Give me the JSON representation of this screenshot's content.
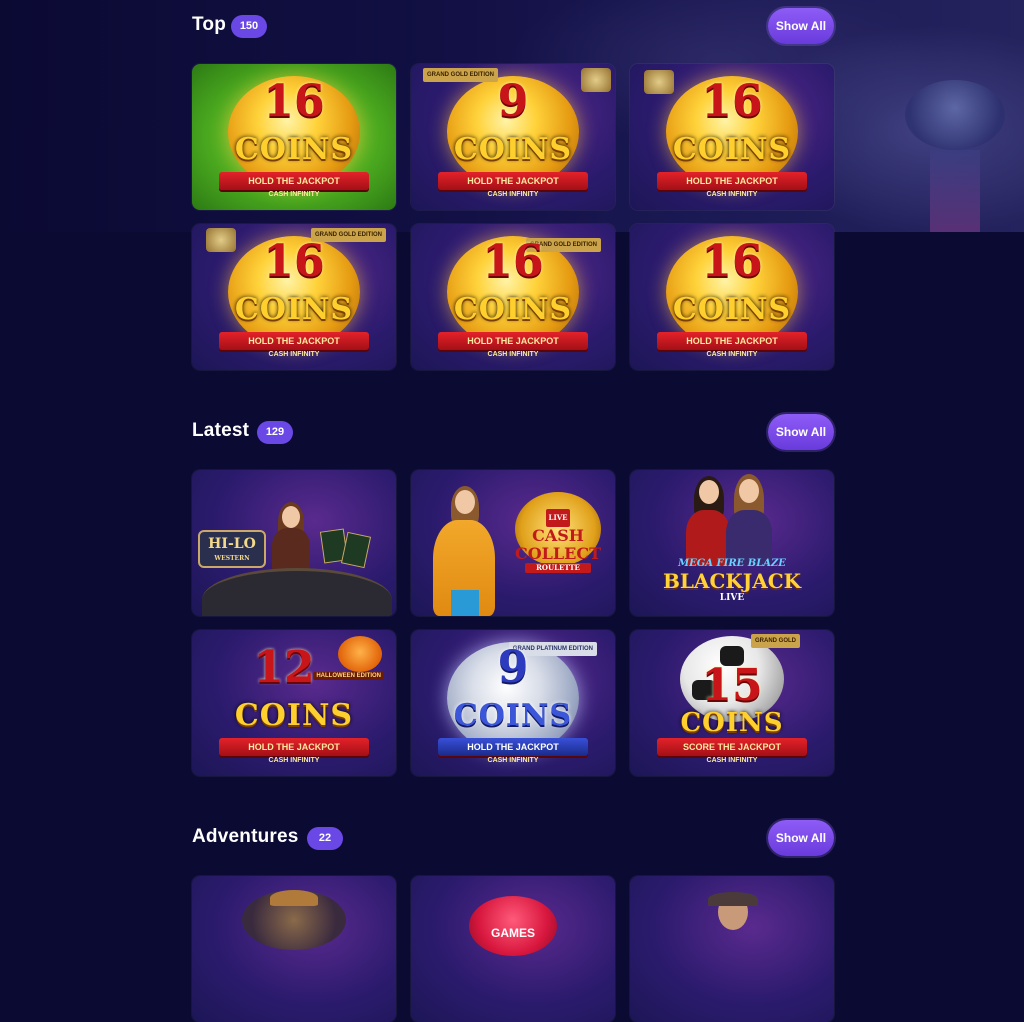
{
  "sections": [
    {
      "title": "Top",
      "count": "150",
      "show_all": "Show All",
      "games": [
        {
          "number": "16",
          "word": "COINS",
          "ribbon": "HOLD THE JACKPOT",
          "sub": "CASH INFINITY"
        },
        {
          "number": "9",
          "word": "COINS",
          "ribbon": "HOLD THE JACKPOT",
          "sub": "CASH INFINITY",
          "badge": "GRAND GOLD EDITION"
        },
        {
          "number": "16",
          "word": "COINS",
          "ribbon": "HOLD THE JACKPOT",
          "sub": "CASH INFINITY"
        },
        {
          "number": "16",
          "word": "COINS",
          "ribbon": "HOLD THE JACKPOT",
          "sub": "CASH INFINITY",
          "badge": "GRAND GOLD EDITION"
        },
        {
          "number": "16",
          "word": "COINS",
          "ribbon": "HOLD THE JACKPOT",
          "sub": "CASH INFINITY",
          "badge": "GRAND GOLD EDITION"
        },
        {
          "number": "16",
          "word": "COINS",
          "ribbon": "HOLD THE JACKPOT",
          "sub": "CASH INFINITY"
        }
      ]
    },
    {
      "title": "Latest",
      "count": "129",
      "show_all": "Show All",
      "games": [
        {
          "logo": "HI-LO",
          "logo_sub": "WESTERN"
        },
        {
          "logo": "CASH COLLECT",
          "logo_sub": "ROULETTE",
          "tag": "LIVE"
        },
        {
          "logo": "BLACKJACK",
          "logo_top": "MEGA FIRE BLAZE",
          "logo_sub": "LIVE"
        },
        {
          "number": "12",
          "word": "COINS",
          "ribbon": "HOLD THE JACKPOT",
          "sub": "CASH INFINITY",
          "badge": "HALLOWEEN EDITION"
        },
        {
          "number": "9",
          "word": "COINS",
          "ribbon": "HOLD THE JACKPOT",
          "sub": "CASH INFINITY",
          "badge": "GRAND PLATINUM EDITION"
        },
        {
          "number": "15",
          "word": "COINS",
          "ribbon": "SCORE THE JACKPOT",
          "sub": "CASH INFINITY",
          "badge": "GRAND GOLD"
        }
      ]
    },
    {
      "title": "Adventures",
      "count": "22",
      "show_all": "Show All",
      "games": [
        {
          "label": ""
        },
        {
          "label": "GAMES"
        },
        {
          "label": ""
        }
      ]
    }
  ]
}
